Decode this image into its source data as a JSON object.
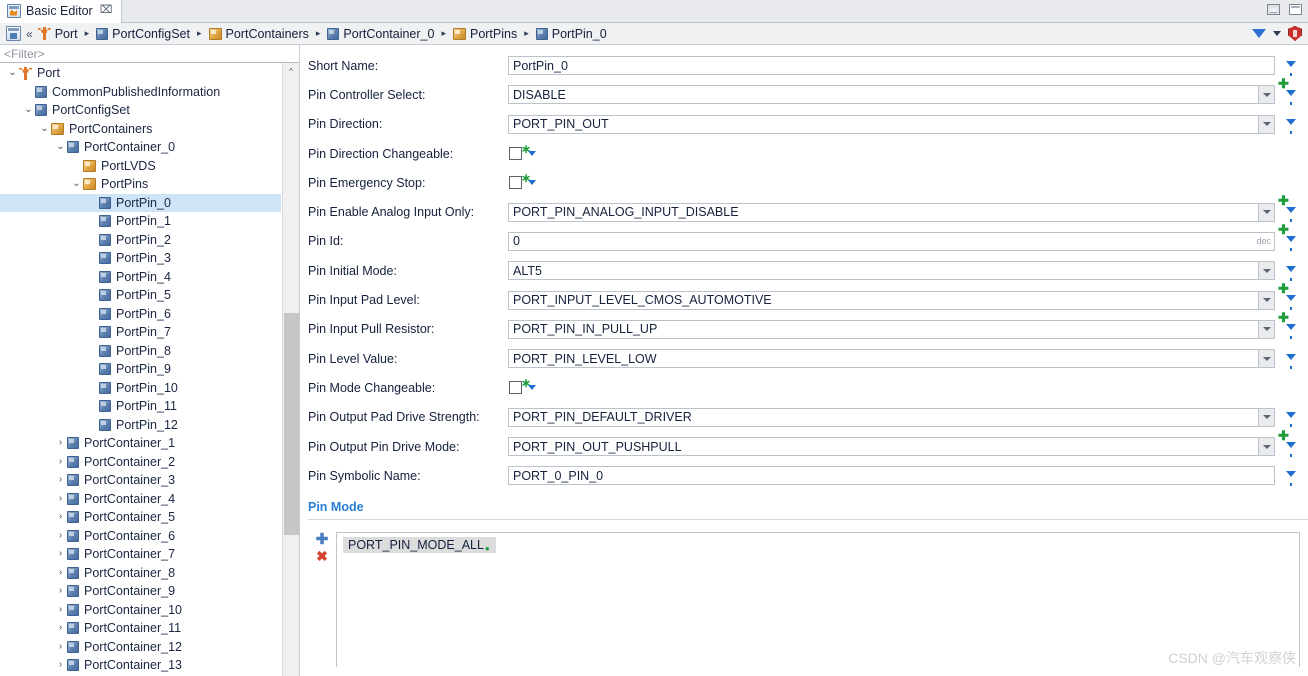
{
  "window": {
    "tab_label": "Basic Editor",
    "tab_icon": "editor-icon",
    "tab_close": "⌧",
    "minimize_label": "",
    "maximize_label": ""
  },
  "breadcrumb": {
    "home_icon": "home-icon",
    "collapse_icon": "«",
    "separator": "▸",
    "items": [
      {
        "label": "Port",
        "icon": "port-module-icon"
      },
      {
        "label": "PortConfigSet",
        "icon": "container-icon"
      },
      {
        "label": "PortContainers",
        "icon": "container-list-icon"
      },
      {
        "label": "PortContainer_0",
        "icon": "container-icon"
      },
      {
        "label": "PortPins",
        "icon": "container-list-icon"
      },
      {
        "label": "PortPin_0",
        "icon": "container-icon"
      }
    ],
    "filter_icon": "filter-icon",
    "filter_dropdown_icon": "chevron-down-icon",
    "validate_icon": "shield-icon"
  },
  "tree": {
    "filter_placeholder": "<Filter>",
    "scroll_up_icon": "^",
    "nodes": [
      {
        "label": "Port",
        "indent": 0,
        "twist": "v",
        "icon": "port-module-icon",
        "selected": false
      },
      {
        "label": "CommonPublishedInformation",
        "indent": 1,
        "twist": "",
        "icon": "container-icon",
        "selected": false
      },
      {
        "label": "PortConfigSet",
        "indent": 1,
        "twist": "v",
        "icon": "container-icon",
        "selected": false
      },
      {
        "label": "PortContainers",
        "indent": 2,
        "twist": "v",
        "icon": "container-list-icon",
        "selected": false
      },
      {
        "label": "PortContainer_0",
        "indent": 3,
        "twist": "v",
        "icon": "container-icon",
        "selected": false
      },
      {
        "label": "PortLVDS",
        "indent": 4,
        "twist": "",
        "icon": "container-list-icon",
        "selected": false
      },
      {
        "label": "PortPins",
        "indent": 4,
        "twist": "v",
        "icon": "container-list-icon",
        "selected": false
      },
      {
        "label": "PortPin_0",
        "indent": 5,
        "twist": "",
        "icon": "container-icon",
        "selected": true
      },
      {
        "label": "PortPin_1",
        "indent": 5,
        "twist": "",
        "icon": "container-icon",
        "selected": false
      },
      {
        "label": "PortPin_2",
        "indent": 5,
        "twist": "",
        "icon": "container-icon",
        "selected": false
      },
      {
        "label": "PortPin_3",
        "indent": 5,
        "twist": "",
        "icon": "container-icon",
        "selected": false
      },
      {
        "label": "PortPin_4",
        "indent": 5,
        "twist": "",
        "icon": "container-icon",
        "selected": false
      },
      {
        "label": "PortPin_5",
        "indent": 5,
        "twist": "",
        "icon": "container-icon",
        "selected": false
      },
      {
        "label": "PortPin_6",
        "indent": 5,
        "twist": "",
        "icon": "container-icon",
        "selected": false
      },
      {
        "label": "PortPin_7",
        "indent": 5,
        "twist": "",
        "icon": "container-icon",
        "selected": false
      },
      {
        "label": "PortPin_8",
        "indent": 5,
        "twist": "",
        "icon": "container-icon",
        "selected": false
      },
      {
        "label": "PortPin_9",
        "indent": 5,
        "twist": "",
        "icon": "container-icon",
        "selected": false
      },
      {
        "label": "PortPin_10",
        "indent": 5,
        "twist": "",
        "icon": "container-icon",
        "selected": false
      },
      {
        "label": "PortPin_11",
        "indent": 5,
        "twist": "",
        "icon": "container-icon",
        "selected": false
      },
      {
        "label": "PortPin_12",
        "indent": 5,
        "twist": "",
        "icon": "container-icon",
        "selected": false
      },
      {
        "label": "PortContainer_1",
        "indent": 3,
        "twist": ">",
        "icon": "container-icon",
        "selected": false
      },
      {
        "label": "PortContainer_2",
        "indent": 3,
        "twist": ">",
        "icon": "container-icon",
        "selected": false
      },
      {
        "label": "PortContainer_3",
        "indent": 3,
        "twist": ">",
        "icon": "container-icon",
        "selected": false
      },
      {
        "label": "PortContainer_4",
        "indent": 3,
        "twist": ">",
        "icon": "container-icon",
        "selected": false
      },
      {
        "label": "PortContainer_5",
        "indent": 3,
        "twist": ">",
        "icon": "container-icon",
        "selected": false
      },
      {
        "label": "PortContainer_6",
        "indent": 3,
        "twist": ">",
        "icon": "container-icon",
        "selected": false
      },
      {
        "label": "PortContainer_7",
        "indent": 3,
        "twist": ">",
        "icon": "container-icon",
        "selected": false
      },
      {
        "label": "PortContainer_8",
        "indent": 3,
        "twist": ">",
        "icon": "container-icon",
        "selected": false
      },
      {
        "label": "PortContainer_9",
        "indent": 3,
        "twist": ">",
        "icon": "container-icon",
        "selected": false
      },
      {
        "label": "PortContainer_10",
        "indent": 3,
        "twist": ">",
        "icon": "container-icon",
        "selected": false
      },
      {
        "label": "PortContainer_11",
        "indent": 3,
        "twist": ">",
        "icon": "container-icon",
        "selected": false
      },
      {
        "label": "PortContainer_12",
        "indent": 3,
        "twist": ">",
        "icon": "container-icon",
        "selected": false
      },
      {
        "label": "PortContainer_13",
        "indent": 3,
        "twist": ">",
        "icon": "container-icon",
        "selected": false
      }
    ]
  },
  "form": {
    "fields": [
      {
        "label": "Short Name:",
        "value": "PortPin_0",
        "type": "text",
        "combo": false,
        "plus": false,
        "filter": true,
        "badge": ""
      },
      {
        "label": "Pin Controller Select:",
        "value": "DISABLE",
        "type": "text",
        "combo": true,
        "plus": true,
        "filter": true,
        "badge": ""
      },
      {
        "label": "Pin Direction:",
        "value": "PORT_PIN_OUT",
        "type": "text",
        "combo": true,
        "plus": false,
        "filter": true,
        "badge": ""
      },
      {
        "label": "Pin Direction Changeable:",
        "value": "",
        "type": "checkbox",
        "checked": false,
        "combo": false,
        "plus": true,
        "filter": true,
        "badge": ""
      },
      {
        "label": "Pin Emergency Stop:",
        "value": "",
        "type": "checkbox",
        "checked": false,
        "combo": false,
        "plus": true,
        "filter": true,
        "badge": ""
      },
      {
        "label": "Pin Enable Analog Input Only:",
        "value": "PORT_PIN_ANALOG_INPUT_DISABLE",
        "type": "text",
        "combo": true,
        "plus": true,
        "filter": true,
        "badge": ""
      },
      {
        "label": "Pin Id:",
        "value": "0",
        "type": "text",
        "combo": false,
        "plus": true,
        "filter": true,
        "badge": "dec"
      },
      {
        "label": "Pin Initial Mode:",
        "value": "ALT5",
        "type": "text",
        "combo": true,
        "plus": false,
        "filter": true,
        "badge": ""
      },
      {
        "label": "Pin Input Pad Level:",
        "value": "PORT_INPUT_LEVEL_CMOS_AUTOMOTIVE",
        "type": "text",
        "combo": true,
        "plus": true,
        "filter": true,
        "badge": ""
      },
      {
        "label": "Pin Input Pull Resistor:",
        "value": "PORT_PIN_IN_PULL_UP",
        "type": "text",
        "combo": true,
        "plus": true,
        "filter": true,
        "badge": ""
      },
      {
        "label": "Pin Level Value:",
        "value": "PORT_PIN_LEVEL_LOW",
        "type": "text",
        "combo": true,
        "plus": false,
        "filter": true,
        "badge": ""
      },
      {
        "label": "Pin Mode Changeable:",
        "value": "",
        "type": "checkbox",
        "checked": false,
        "combo": false,
        "plus": true,
        "filter": true,
        "badge": ""
      },
      {
        "label": "Pin Output Pad Drive Strength:",
        "value": "PORT_PIN_DEFAULT_DRIVER",
        "type": "text",
        "combo": true,
        "plus": false,
        "filter": true,
        "badge": ""
      },
      {
        "label": "Pin Output Pin Drive Mode:",
        "value": "PORT_PIN_OUT_PUSHPULL",
        "type": "text",
        "combo": true,
        "plus": true,
        "filter": true,
        "badge": ""
      },
      {
        "label": "Pin Symbolic Name:",
        "value": "PORT_0_PIN_0",
        "type": "text",
        "combo": false,
        "plus": false,
        "filter": true,
        "badge": ""
      }
    ]
  },
  "pin_mode": {
    "title": "Pin Mode",
    "add_icon": "✚",
    "delete_icon": "✖",
    "items": [
      {
        "label": "PORT_PIN_MODE_ALL",
        "marker": "•"
      }
    ]
  },
  "watermark": {
    "text": "CSDN @汽车观察侠"
  },
  "colors": {
    "accent_blue": "#2a7fd4",
    "selection": "#cfe4f7",
    "green_marker": "#1f9d3a",
    "red_delete": "#d0422f",
    "orange_icon": "#e2762a"
  }
}
